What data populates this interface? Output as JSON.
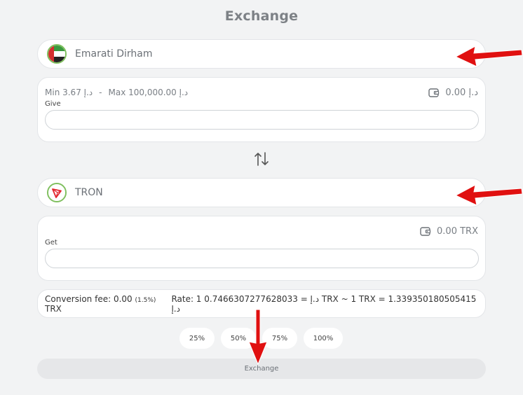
{
  "page": {
    "title": "Exchange"
  },
  "from": {
    "currency_name": "Emarati Dirham",
    "min_label": "Min 3.67 د.إ",
    "separator": "-",
    "max_label": "Max 100,000.00 د.إ",
    "balance": "د.إ 0.00",
    "field_label": "Give",
    "field_value": ""
  },
  "to": {
    "currency_name": "TRON",
    "balance": "0.00 TRX",
    "field_label": "Get",
    "field_value": ""
  },
  "info": {
    "fee_label": "Conversion fee: 0.00",
    "fee_percent": "(1.5%)",
    "fee_unit": "TRX",
    "rate": "Rate: 1 د.إ = 0.7466307277628033 TRX ~ 1 TRX = 1.339350180505415 د.إ"
  },
  "percent_buttons": [
    "25%",
    "50%",
    "75%",
    "100%"
  ],
  "submit": {
    "label": "Exchange"
  },
  "icons": {
    "swap": "swap-vertical-icon",
    "wallet": "wallet-icon",
    "from_flag": "uae-flag-icon",
    "to_flag": "tron-logo-icon",
    "annotation": "red-arrow-icon"
  },
  "colors": {
    "arrow": "#e01010",
    "flag_ring": "#7fbf5e",
    "tron_red": "#e3262e"
  }
}
